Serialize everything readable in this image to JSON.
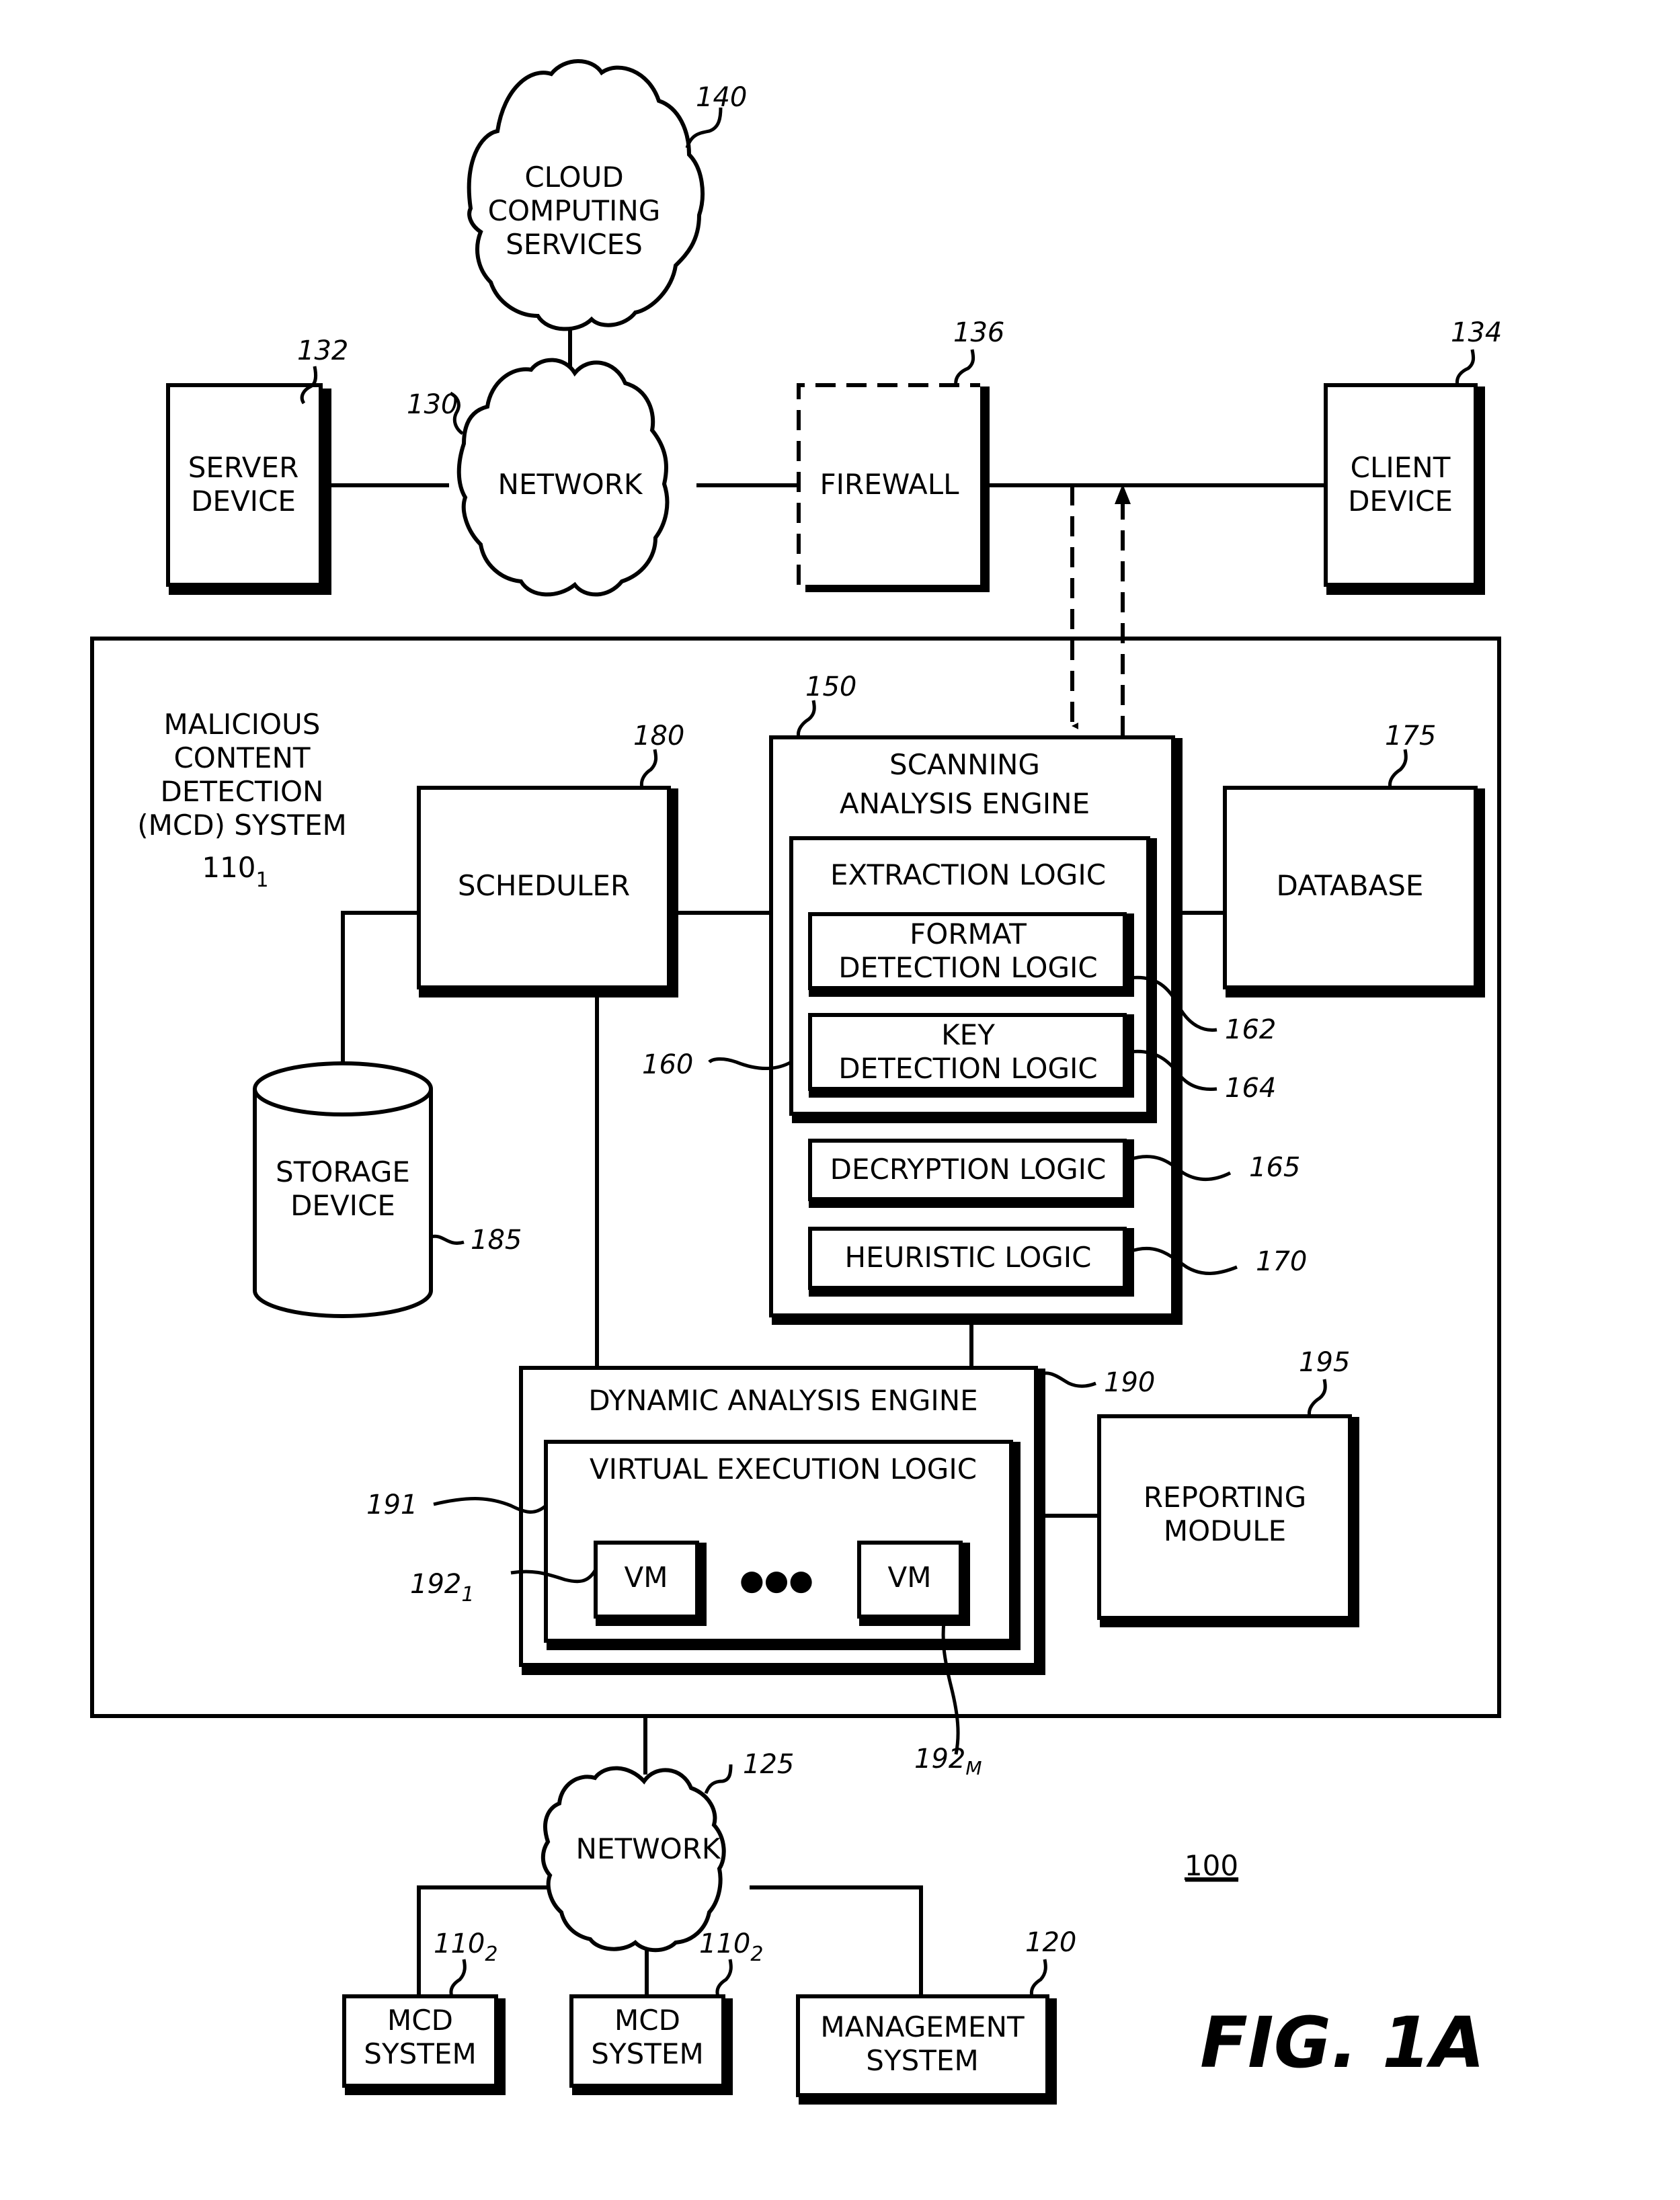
{
  "figure": {
    "title": "FIG. 1A",
    "system_ref": "100"
  },
  "top": {
    "cloud_services": {
      "lines": [
        "CLOUD",
        "COMPUTING",
        "SERVICES"
      ],
      "ref": "140"
    },
    "network": {
      "label": "NETWORK",
      "ref": "130"
    },
    "server_device": {
      "lines": [
        "SERVER",
        "DEVICE"
      ],
      "ref": "132"
    },
    "firewall": {
      "label": "FIREWALL",
      "ref": "136"
    },
    "client_device": {
      "lines": [
        "CLIENT",
        "DEVICE"
      ],
      "ref": "134"
    }
  },
  "mcd_system": {
    "lines": [
      "MALICIOUS",
      "CONTENT",
      "DETECTION",
      "(MCD) SYSTEM"
    ],
    "ref_base": "110",
    "ref_sub": "1",
    "scheduler": {
      "label": "SCHEDULER",
      "ref": "180"
    },
    "storage_device": {
      "lines": [
        "STORAGE",
        "DEVICE"
      ],
      "ref": "185"
    },
    "database": {
      "label": "DATABASE",
      "ref": "175"
    },
    "scanning_engine": {
      "lines": [
        "SCANNING",
        "ANALYSIS ENGINE"
      ],
      "ref": "150",
      "extraction_logic": {
        "label": "EXTRACTION LOGIC",
        "ref": "160"
      },
      "format_detection": {
        "lines": [
          "FORMAT",
          "DETECTION LOGIC"
        ],
        "ref": "162"
      },
      "key_detection": {
        "lines": [
          "KEY",
          "DETECTION LOGIC"
        ],
        "ref": "164"
      },
      "decryption": {
        "label": "DECRYPTION LOGIC",
        "ref": "165"
      },
      "heuristic": {
        "label": "HEURISTIC LOGIC",
        "ref": "170"
      }
    },
    "dynamic_engine": {
      "label": "DYNAMIC ANALYSIS ENGINE",
      "ref": "190",
      "virtual_execution": {
        "label": "VIRTUAL EXECUTION LOGIC",
        "ref": "191"
      },
      "vm_first": {
        "label": "VM",
        "ref_base": "192",
        "ref_sub": "1"
      },
      "vm_last": {
        "label": "VM",
        "ref_base": "192",
        "ref_sub": "M"
      },
      "ellipsis": "●●●"
    },
    "reporting": {
      "lines": [
        "REPORTING",
        "MODULE"
      ],
      "ref": "195"
    }
  },
  "bottom": {
    "network": {
      "label": "NETWORK",
      "ref": "125"
    },
    "mcd_a": {
      "lines": [
        "MCD",
        "SYSTEM"
      ],
      "ref_base": "110",
      "ref_sub": "2"
    },
    "mcd_b": {
      "lines": [
        "MCD",
        "SYSTEM"
      ],
      "ref_base": "110",
      "ref_sub": "2"
    },
    "management": {
      "lines": [
        "MANAGEMENT",
        "SYSTEM"
      ],
      "ref": "120"
    }
  }
}
